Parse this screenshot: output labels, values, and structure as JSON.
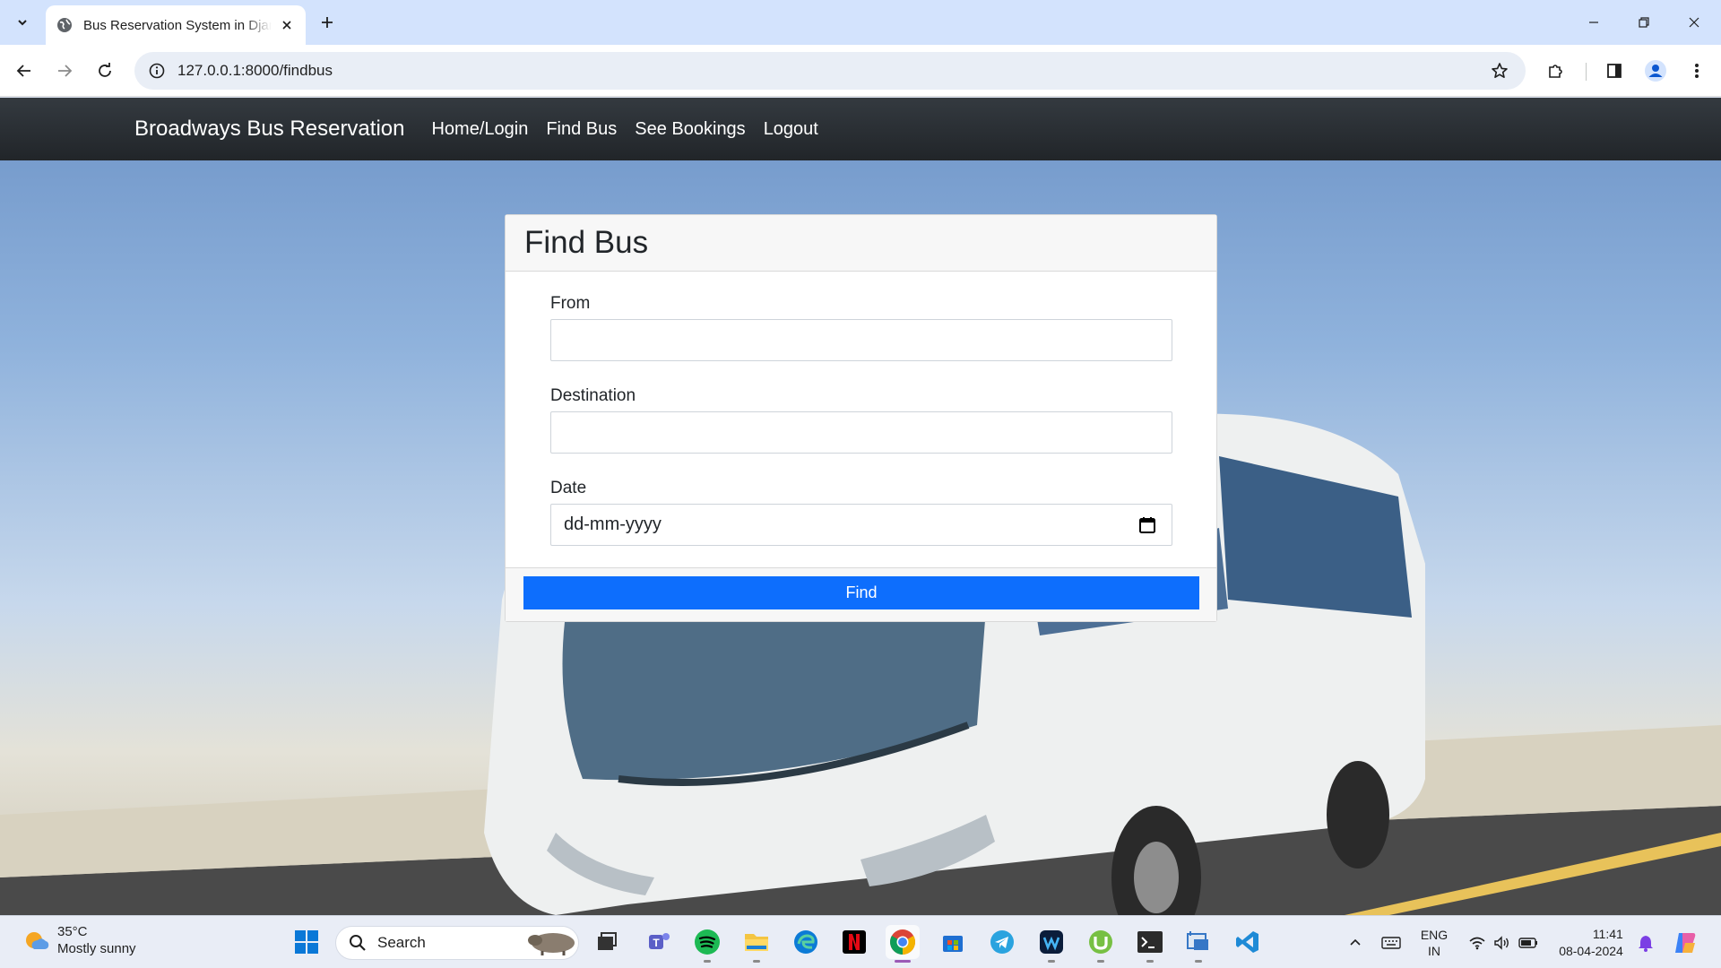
{
  "browser": {
    "tab_title": "Bus Reservation System in Django",
    "url": "127.0.0.1:8000/findbus"
  },
  "site": {
    "brand": "Broadways Bus Reservation",
    "nav": [
      "Home/Login",
      "Find Bus",
      "See Bookings",
      "Logout"
    ]
  },
  "form": {
    "title": "Find Bus",
    "from_label": "From",
    "from_value": "",
    "destination_label": "Destination",
    "destination_value": "",
    "date_label": "Date",
    "date_placeholder": "dd-mm-yyyy",
    "submit_label": "Find"
  },
  "taskbar": {
    "weather_temp": "35°C",
    "weather_condition": "Mostly sunny",
    "search_label": "Search",
    "language": "ENG",
    "region": "IN",
    "time": "11:41",
    "date": "08-04-2024",
    "apps": [
      "task-view-icon",
      "teams-icon",
      "spotify-icon",
      "file-explorer-icon",
      "edge-icon",
      "netflix-icon",
      "chrome-icon",
      "store-icon",
      "telegram-icon",
      "webex-icon",
      "utorrent-icon",
      "terminal-icon",
      "vmware-icon",
      "vscode-icon"
    ]
  },
  "colors": {
    "navbar": "#212529",
    "primary_button": "#0d6efd",
    "tab_strip": "#d3e3fd"
  }
}
